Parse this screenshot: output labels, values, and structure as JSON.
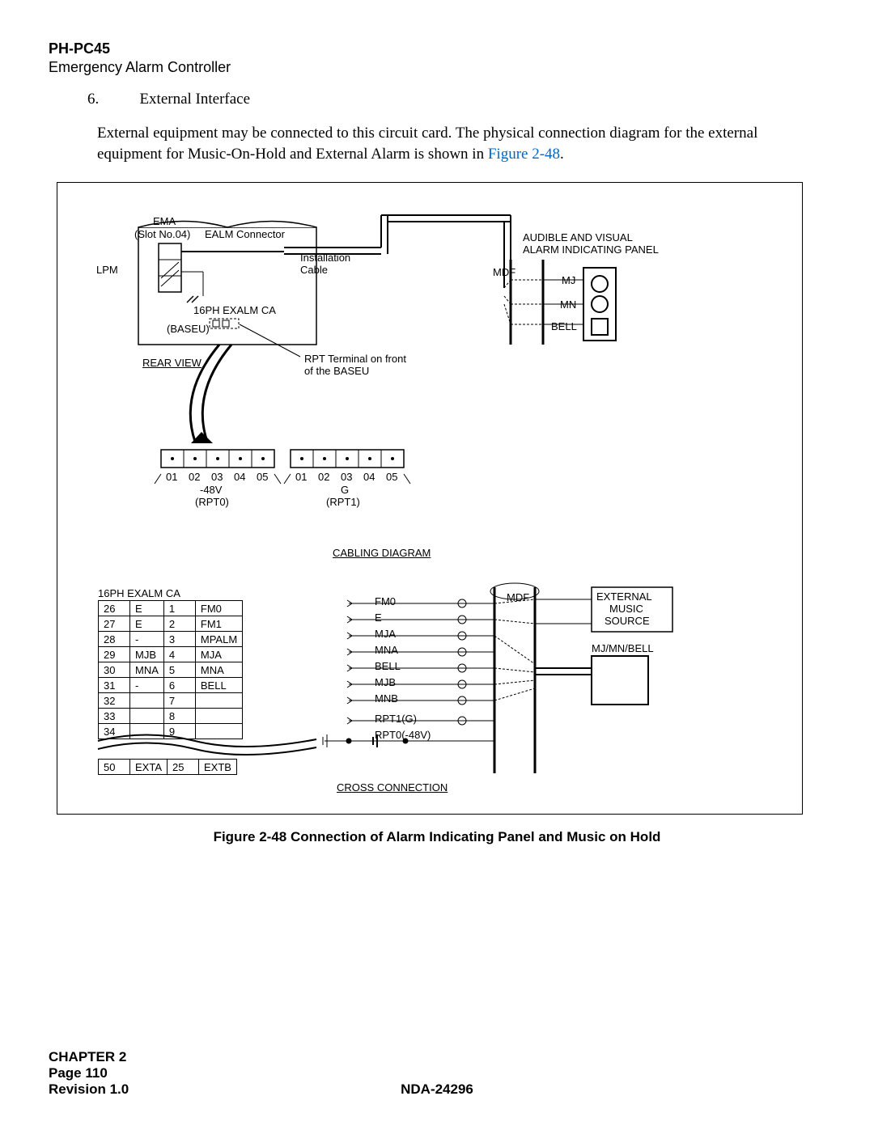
{
  "header": {
    "code": "PH-PC45",
    "subtitle": "Emergency Alarm Controller"
  },
  "section": {
    "number": "6.",
    "title": "External Interface",
    "body_a": "External equipment may be connected to this circuit card.  The physical connection diagram for the external equipment for Music-On-Hold and External Alarm is shown in ",
    "figref": "Figure 2-48",
    "body_b": "."
  },
  "figure": {
    "caption": "Figure 2-48    Connection of Alarm Indicating Panel and Music on Hold",
    "labels": {
      "ema": "EMA",
      "slot": "(Slot No.04)",
      "ealm_conn": "EALM Connector",
      "install_cable_a": "Installation",
      "install_cable_b": "Cable",
      "lpm": "LPM",
      "exalm_ca": "16PH EXALM CA",
      "baseu": "(BASEU)",
      "rear_view": "REAR VIEW",
      "rpt_front_a": "RPT Terminal on front",
      "rpt_front_b": "of the BASEU",
      "mdf": "MDF",
      "aud_vis_a": "AUDIBLE AND VISUAL",
      "aud_vis_b": "ALARM INDICATING PANEL",
      "mj": "MJ",
      "mn": "MN",
      "bell": "BELL",
      "rpt0_a": "-48V",
      "rpt0_b": "(RPT0)",
      "rpt1_a": "G",
      "rpt1_b": "(RPT1)",
      "cabling": "CABLING DIAGRAM",
      "exalm_ca2": "16PH EXALM CA",
      "mdf2": "MDF",
      "ext_music_a": "EXTERNAL",
      "ext_music_b": "MUSIC",
      "ext_music_c": "SOURCE",
      "mj_mn_bell": "MJ/MN/BELL",
      "cross": "CROSS CONNECTION",
      "sig_fm0": "FM0",
      "sig_e": "E",
      "sig_mja": "MJA",
      "sig_mna": "MNA",
      "sig_bell": "BELL",
      "sig_mjb": "MJB",
      "sig_mnb": "MNB",
      "sig_rpt1g": "RPT1(G)",
      "sig_rpt0_48v": "RPT0(-48V)"
    },
    "terminals_a": [
      "01",
      "02",
      "03",
      "04",
      "05"
    ],
    "terminals_b": [
      "01",
      "02",
      "03",
      "04",
      "05"
    ],
    "pin_table": {
      "rows": [
        [
          "26",
          "E",
          "1",
          "FM0"
        ],
        [
          "27",
          "E",
          "2",
          "FM1"
        ],
        [
          "28",
          "-",
          "3",
          "MPALM"
        ],
        [
          "29",
          "MJB",
          "4",
          "MJA"
        ],
        [
          "30",
          "MNA",
          "5",
          "MNA"
        ],
        [
          "31",
          "-",
          "6",
          "BELL"
        ],
        [
          "32",
          "",
          "7",
          ""
        ],
        [
          "33",
          "",
          "8",
          ""
        ],
        [
          "34",
          "",
          "9",
          ""
        ]
      ],
      "tail": [
        "50",
        "EXTA",
        "25",
        "EXTB"
      ]
    }
  },
  "footer": {
    "chapter": "CHAPTER 2",
    "doc": "NDA-24296",
    "page": "Page 110",
    "revision": "Revision 1.0"
  }
}
